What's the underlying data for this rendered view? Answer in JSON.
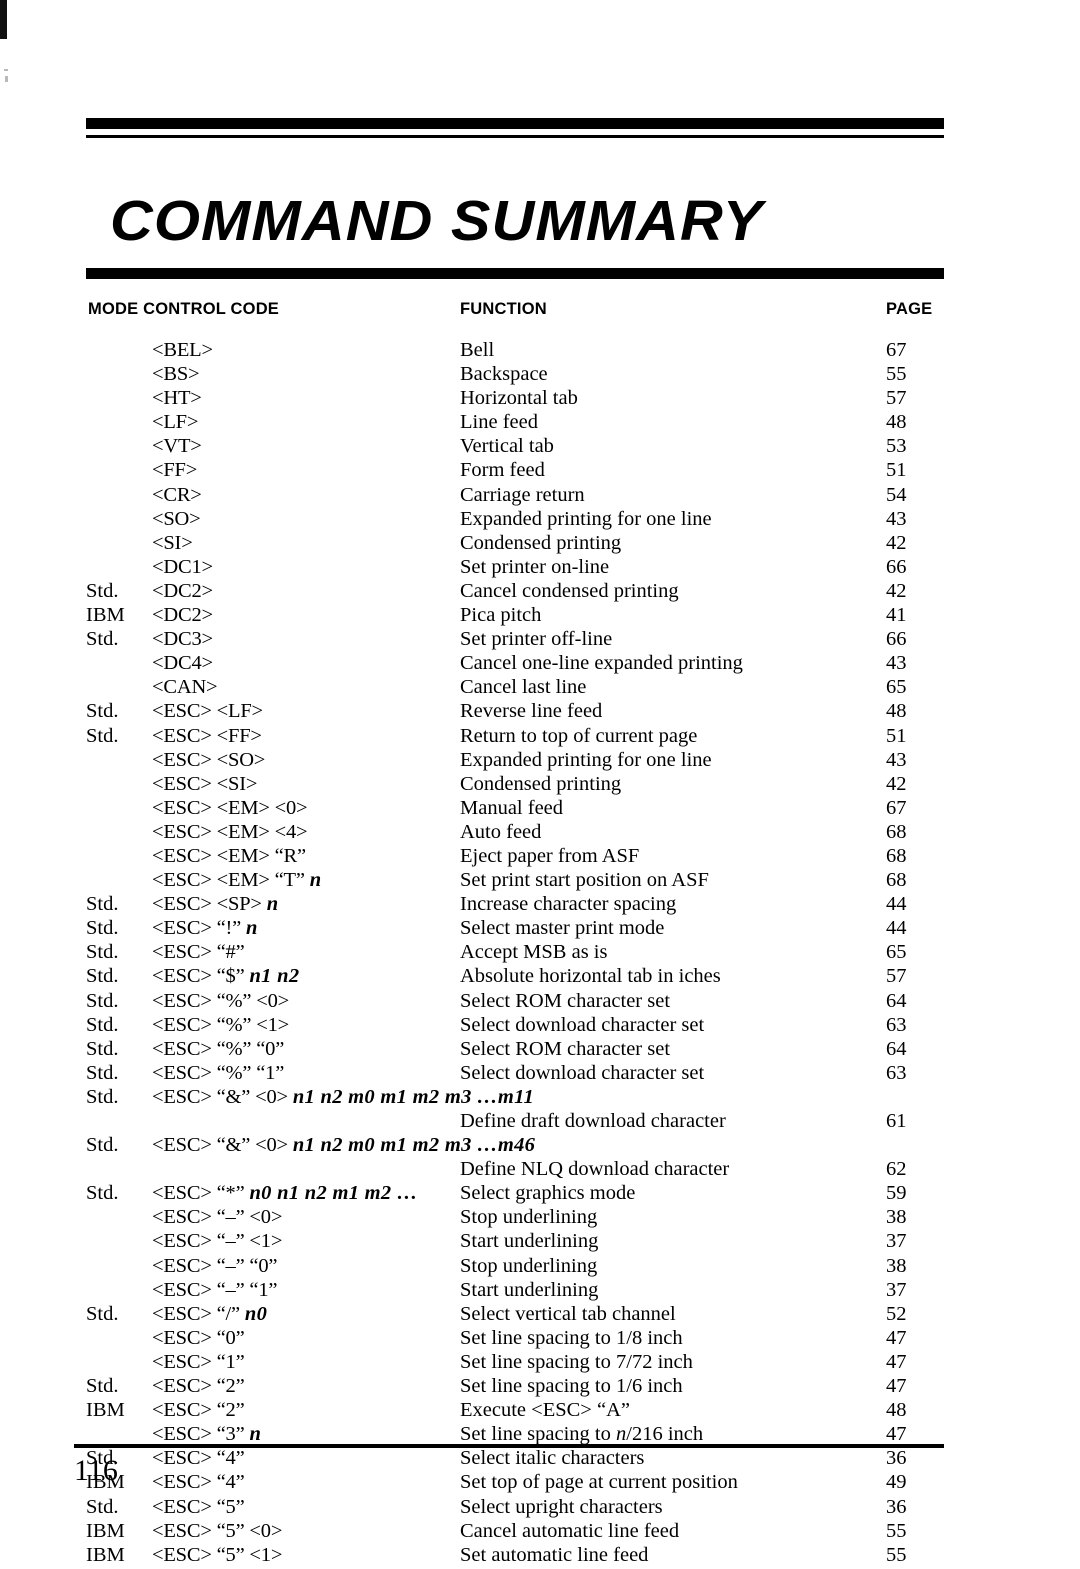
{
  "chapter_title": "COMMAND SUMMARY",
  "columns": {
    "mode": "MODE",
    "control_code": "CONTROL CODE",
    "mode_control_code": "MODE CONTROL CODE",
    "function": "FUNCTION",
    "page": "PAGE"
  },
  "folio": "116",
  "rows": [
    {
      "mode": "",
      "code": "<BEL>",
      "params": "",
      "function": "Bell",
      "page": "67"
    },
    {
      "mode": "",
      "code": "<BS>",
      "params": "",
      "function": "Backspace",
      "page": "55"
    },
    {
      "mode": "",
      "code": "<HT>",
      "params": "",
      "function": "Horizontal tab",
      "page": "57"
    },
    {
      "mode": "",
      "code": "<LF>",
      "params": "",
      "function": "Line feed",
      "page": "48"
    },
    {
      "mode": "",
      "code": "<VT>",
      "params": "",
      "function": "Vertical tab",
      "page": "53"
    },
    {
      "mode": "",
      "code": "<FF>",
      "params": "",
      "function": "Form feed",
      "page": "51"
    },
    {
      "mode": "",
      "code": "<CR>",
      "params": "",
      "function": "Carriage return",
      "page": "54"
    },
    {
      "mode": "",
      "code": "<SO>",
      "params": "",
      "function": "Expanded printing for one line",
      "page": "43"
    },
    {
      "mode": "",
      "code": "<SI>",
      "params": "",
      "function": "Condensed printing",
      "page": "42"
    },
    {
      "mode": "",
      "code": "<DC1>",
      "params": "",
      "function": "Set printer on-line",
      "page": "66"
    },
    {
      "mode": "Std.",
      "code": "<DC2>",
      "params": "",
      "function": "Cancel condensed printing",
      "page": "42"
    },
    {
      "mode": "IBM",
      "code": "<DC2>",
      "params": "",
      "function": "Pica pitch",
      "page": "41"
    },
    {
      "mode": "Std.",
      "code": "<DC3>",
      "params": "",
      "function": "Set printer off-line",
      "page": "66"
    },
    {
      "mode": "",
      "code": "<DC4>",
      "params": "",
      "function": "Cancel one-line expanded printing",
      "page": "43"
    },
    {
      "mode": "",
      "code": "<CAN>",
      "params": "",
      "function": "Cancel last line",
      "page": "65"
    },
    {
      "mode": "Std.",
      "code": "<ESC> <LF>",
      "params": "",
      "function": "Reverse line feed",
      "page": "48"
    },
    {
      "mode": "Std.",
      "code": "<ESC> <FF>",
      "params": "",
      "function": "Return to top of current page",
      "page": "51"
    },
    {
      "mode": "",
      "code": "<ESC> <SO>",
      "params": "",
      "function": "Expanded printing for one line",
      "page": "43"
    },
    {
      "mode": "",
      "code": "<ESC> <SI>",
      "params": "",
      "function": "Condensed printing",
      "page": "42"
    },
    {
      "mode": "",
      "code": "<ESC> <EM> <0>",
      "params": "",
      "function": "Manual feed",
      "page": "67"
    },
    {
      "mode": "",
      "code": "<ESC> <EM> <4>",
      "params": "",
      "function": "Auto feed",
      "page": "68"
    },
    {
      "mode": "",
      "code": "<ESC> <EM> “R”",
      "params": "",
      "function": "Eject paper from ASF",
      "page": "68"
    },
    {
      "mode": "",
      "code": "<ESC> <EM> “T”",
      "params": "n",
      "function": "Set print start position on ASF",
      "page": "68"
    },
    {
      "mode": "Std.",
      "code": "<ESC> <SP>",
      "params": "n",
      "function": "Increase character spacing",
      "page": "44"
    },
    {
      "mode": "Std.",
      "code": "<ESC> “!”",
      "params": "n",
      "function": "Select master print mode",
      "page": "44"
    },
    {
      "mode": "Std.",
      "code": "<ESC> “#”",
      "params": "",
      "function": "Accept MSB as is",
      "page": "65"
    },
    {
      "mode": "Std.",
      "code": "<ESC> “$”",
      "params": "n1 n2",
      "function": "Absolute horizontal tab in iches",
      "page": "57"
    },
    {
      "mode": "Std.",
      "code": "<ESC> “%” <0>",
      "params": "",
      "function": "Select ROM character set",
      "page": "64"
    },
    {
      "mode": "Std.",
      "code": "<ESC> “%” <1>",
      "params": "",
      "function": "Select download character set",
      "page": "63"
    },
    {
      "mode": "Std.",
      "code": "<ESC> “%” “0”",
      "params": "",
      "function": "Select ROM character set",
      "page": "64"
    },
    {
      "mode": "Std.",
      "code": "<ESC> “%” “1”",
      "params": "",
      "function": "Select download character set",
      "page": "63"
    },
    {
      "mode": "Std.",
      "code": "<ESC> “&” <0>",
      "params": "n1 n2 m0 m1 m2 m3 …m11",
      "function": "",
      "page": "",
      "wrap": true
    },
    {
      "mode": "",
      "code": "",
      "params": "",
      "function": "Define draft download character",
      "page": "61"
    },
    {
      "mode": "Std.",
      "code": "<ESC> “&” <0>",
      "params": "n1 n2 m0 m1 m2 m3 …m46",
      "function": "",
      "page": "",
      "wrap": true
    },
    {
      "mode": "",
      "code": "",
      "params": "",
      "function": "Define NLQ download character",
      "page": "62"
    },
    {
      "mode": "Std.",
      "code": "<ESC> “*”",
      "params": "n0 n1 n2 m1 m2 …",
      "function": "Select graphics mode",
      "page": "59"
    },
    {
      "mode": "",
      "code": "<ESC> “–” <0>",
      "params": "",
      "function": "Stop underlining",
      "page": "38"
    },
    {
      "mode": "",
      "code": "<ESC> “–” <1>",
      "params": "",
      "function": "Start underlining",
      "page": "37"
    },
    {
      "mode": "",
      "code": "<ESC> “–” “0”",
      "params": "",
      "function": "Stop underlining",
      "page": "38"
    },
    {
      "mode": "",
      "code": "<ESC> “–” “1”",
      "params": "",
      "function": "Start underlining",
      "page": "37"
    },
    {
      "mode": "Std.",
      "code": "<ESC> “/”",
      "params": "n0",
      "function": "Select vertical tab channel",
      "page": "52"
    },
    {
      "mode": "",
      "code": "<ESC> “0”",
      "params": "",
      "function": "Set line spacing to 1/8 inch",
      "page": "47"
    },
    {
      "mode": "",
      "code": "<ESC> “1”",
      "params": "",
      "function": "Set line spacing to 7/72 inch",
      "page": "47"
    },
    {
      "mode": "Std.",
      "code": "<ESC> “2”",
      "params": "",
      "function": "Set line spacing to 1/6 inch",
      "page": "47"
    },
    {
      "mode": "IBM",
      "code": "<ESC> “2”",
      "params": "",
      "function": "Execute <ESC> “A”",
      "page": "48"
    },
    {
      "mode": "",
      "code": "<ESC> “3”",
      "params": "n",
      "function": "Set line spacing to n/216 inch",
      "page": "47",
      "func_italic_prefix": "Set line spacing to ",
      "func_italic": "n",
      "func_italic_suffix": "/216 inch"
    },
    {
      "mode": "Std.",
      "code": "<ESC> “4”",
      "params": "",
      "function": "Select italic characters",
      "page": "36"
    },
    {
      "mode": "IBM",
      "code": "<ESC> “4”",
      "params": "",
      "function": "Set top of page at current position",
      "page": "49"
    },
    {
      "mode": "Std.",
      "code": "<ESC> “5”",
      "params": "",
      "function": "Select upright characters",
      "page": "36"
    },
    {
      "mode": "IBM",
      "code": "<ESC> “5” <0>",
      "params": "",
      "function": "Cancel automatic line feed",
      "page": "55"
    },
    {
      "mode": "IBM",
      "code": "<ESC> “5” <1>",
      "params": "",
      "function": "Set automatic line feed",
      "page": "55"
    }
  ]
}
